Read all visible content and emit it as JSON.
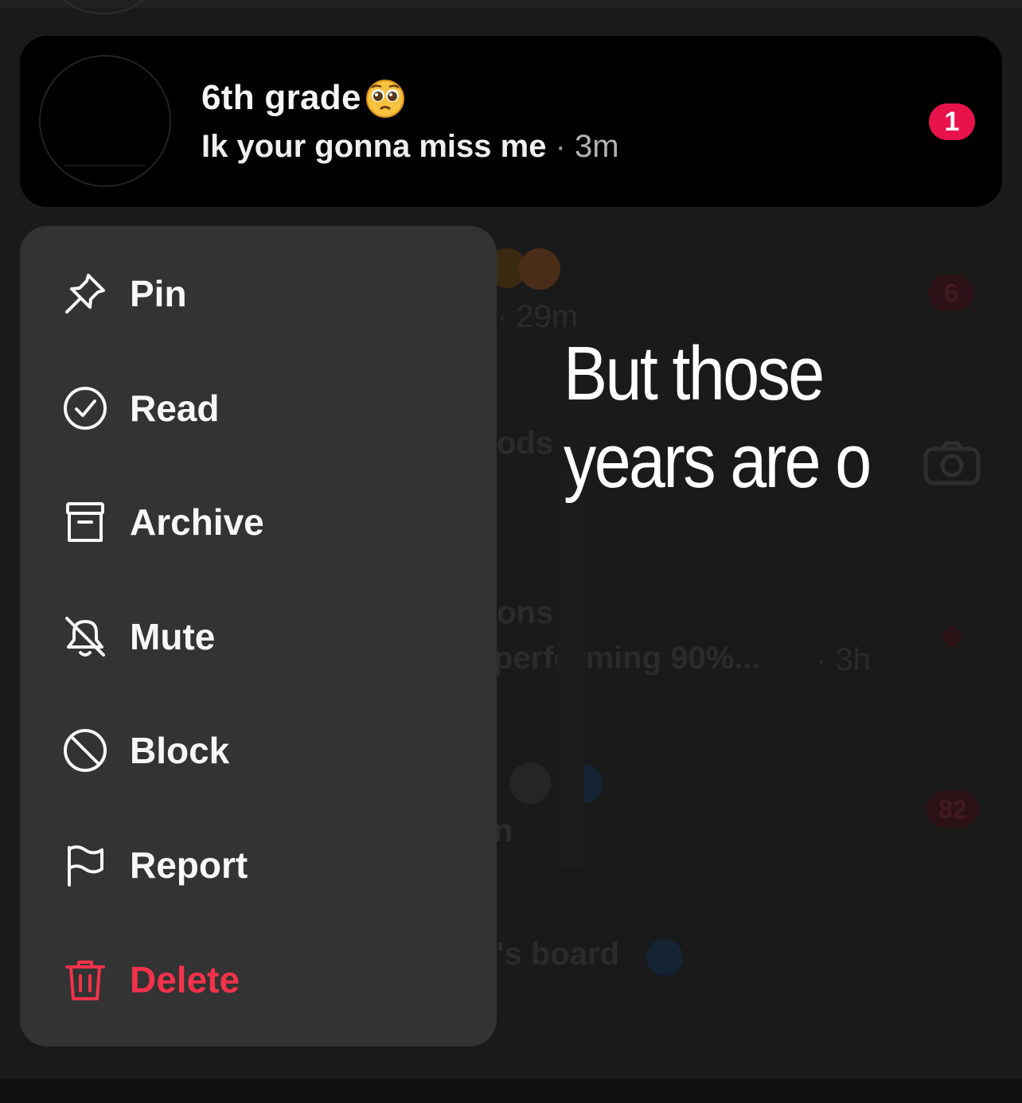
{
  "conversation": {
    "title": "6th grade",
    "title_emoji": "pleading-face-emoji",
    "preview": "Ik your gonna miss me",
    "separator": "·",
    "time": "3m",
    "unread_count": "1"
  },
  "background_list": {
    "fragments": [
      "· 29m",
      "ods",
      "ons",
      "performing 90%...",
      "· 3h",
      "n",
      "'s board"
    ],
    "badges": [
      "6",
      "82"
    ]
  },
  "overlay_caption": "But those years are o",
  "context_menu": {
    "items": [
      {
        "label": "Pin",
        "icon": "pin-icon"
      },
      {
        "label": "Read",
        "icon": "check-circle-icon"
      },
      {
        "label": "Archive",
        "icon": "archive-icon"
      },
      {
        "label": "Mute",
        "icon": "bell-off-icon"
      },
      {
        "label": "Block",
        "icon": "block-icon"
      },
      {
        "label": "Report",
        "icon": "flag-icon"
      },
      {
        "label": "Delete",
        "icon": "trash-icon"
      }
    ]
  },
  "colors": {
    "menu_background": "#333333",
    "card_background": "#000000",
    "badge_red": "#e8134a",
    "danger_red": "#f2324a"
  }
}
